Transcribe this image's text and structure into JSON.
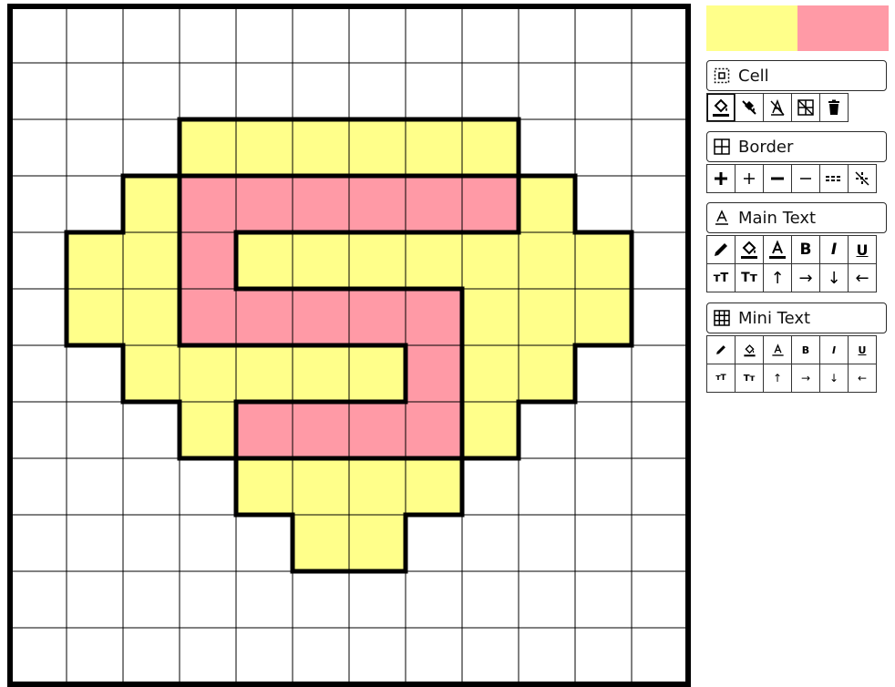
{
  "colors": {
    "yellow": "#ffff8a",
    "pink": "#ff9aa6",
    "white": "#ffffff",
    "line": "#000000"
  },
  "grid": {
    "rows": 12,
    "cols": 12,
    "cells": [
      "............",
      "............",
      "...YYYYYY...",
      "..YPPPPPPY..",
      ".YYPYYYYYYY.",
      ".YYPPPPPYYY.",
      "..YYYYYPYY..",
      "...YPPPPY...",
      "....YYYY....",
      ".....YY.....",
      "............",
      "............"
    ]
  },
  "palette": [
    {
      "name": "yellow",
      "color": "#ffff8a"
    },
    {
      "name": "pink",
      "color": "#ff9aa6"
    }
  ],
  "sections": {
    "cell": {
      "label": "Cell",
      "icon": "cell-select-icon"
    },
    "border": {
      "label": "Border",
      "icon": "border-grid-icon"
    },
    "main_text": {
      "label": "Main Text",
      "icon": "text-underline-icon"
    },
    "mini_text": {
      "label": "Mini Text",
      "icon": "mini-grid-icon"
    }
  },
  "cell_tools": [
    "fill-color-icon",
    "clear-fill-icon",
    "no-text-icon",
    "clear-cell-icon",
    "delete-icon"
  ],
  "border_tools": [
    {
      "icon": "plus-thick-icon",
      "glyph": "+"
    },
    {
      "icon": "plus-thin-icon",
      "glyph": "+"
    },
    {
      "icon": "minus-thick-icon",
      "glyph": "−"
    },
    {
      "icon": "minus-thin-icon",
      "glyph": "–"
    },
    {
      "icon": "dashed-line-icon",
      "glyph": "╌"
    },
    {
      "icon": "no-border-icon",
      "glyph": "⁄"
    }
  ],
  "text_tools_row1": [
    {
      "icon": "pencil-icon",
      "glyph": "✎"
    },
    {
      "icon": "fill-color-icon",
      "glyph": "◈"
    },
    {
      "icon": "font-color-icon",
      "glyph": "A"
    },
    {
      "icon": "bold-icon",
      "glyph": "B"
    },
    {
      "icon": "italic-icon",
      "glyph": "I"
    },
    {
      "icon": "underline-icon",
      "glyph": "U"
    }
  ],
  "text_tools_row2": [
    {
      "icon": "font-size-icon",
      "glyph": "ᴛT"
    },
    {
      "icon": "text-case-icon",
      "glyph": "Tт"
    },
    {
      "icon": "arrow-up-icon",
      "glyph": "↑"
    },
    {
      "icon": "arrow-right-icon",
      "glyph": "→"
    },
    {
      "icon": "arrow-down-icon",
      "glyph": "↓"
    },
    {
      "icon": "arrow-left-icon",
      "glyph": "←"
    }
  ]
}
